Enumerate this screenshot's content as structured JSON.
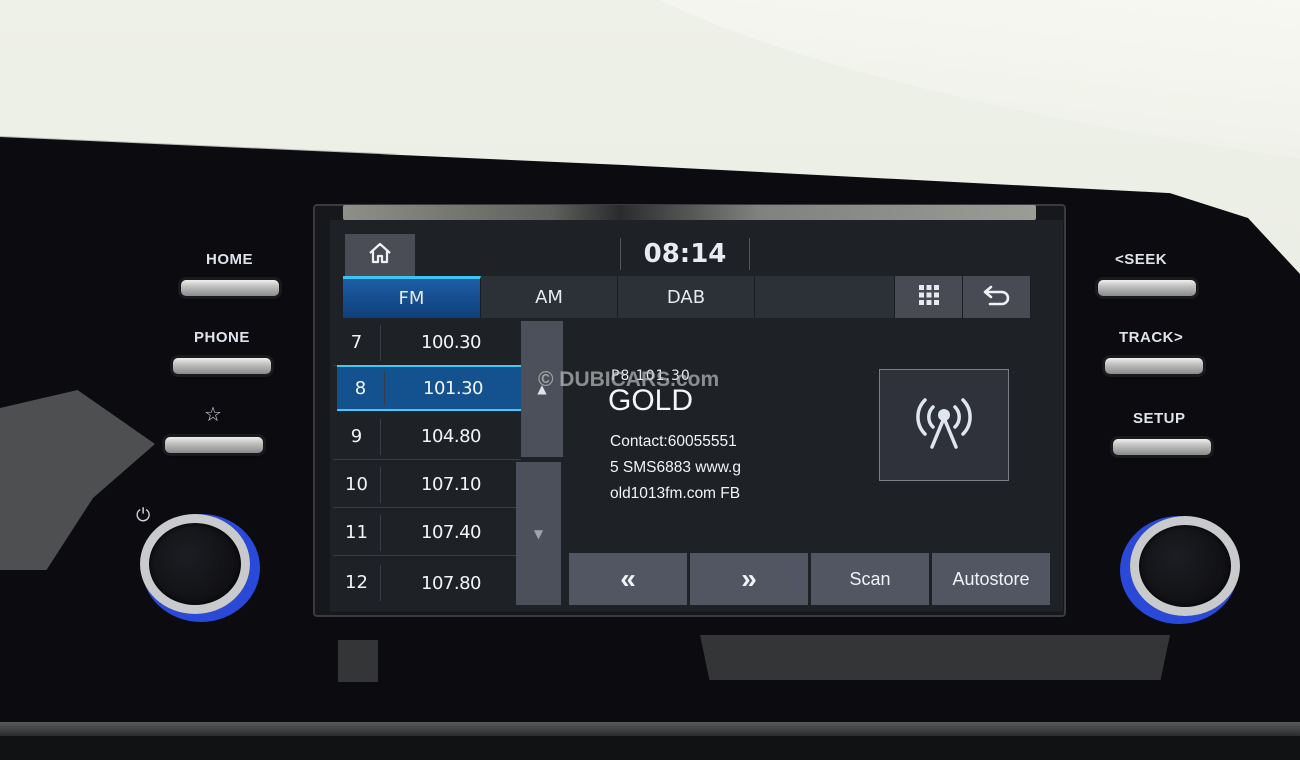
{
  "physical_controls": {
    "left": {
      "home_label": "HOME",
      "phone_label": "PHONE",
      "favorite_icon": "star-icon",
      "power_icon": "power-icon"
    },
    "right": {
      "seek_label": "<SEEK",
      "track_label": "TRACK>",
      "setup_label": "SETUP"
    }
  },
  "screen": {
    "header": {
      "home_icon": "home-icon",
      "clock": "08:14"
    },
    "tabs": [
      {
        "label": "FM",
        "active": true
      },
      {
        "label": "AM",
        "active": false
      },
      {
        "label": "DAB",
        "active": false
      }
    ],
    "tab_icons": {
      "menu": "grid-menu-icon",
      "back": "back-icon"
    },
    "presets": [
      {
        "num": "7",
        "freq": "100.30",
        "selected": false
      },
      {
        "num": "8",
        "freq": "101.30",
        "selected": true
      },
      {
        "num": "9",
        "freq": "104.80",
        "selected": false
      },
      {
        "num": "10",
        "freq": "107.10",
        "selected": false
      },
      {
        "num": "11",
        "freq": "107.40",
        "selected": false
      },
      {
        "num": "12",
        "freq": "107.80",
        "selected": false
      }
    ],
    "scroll": {
      "up_glyph": "▲",
      "down_glyph": "▼"
    },
    "station": {
      "preset_freq": "P8  101.30",
      "name": "GOLD",
      "rds_lines": [
        "Contact:60055551",
        "5 SMS6883 www.g",
        "old1013fm.com FB"
      ],
      "signal_icon": "radio-signal-icon"
    },
    "controls": {
      "prev_glyph": "«",
      "next_glyph": "»",
      "scan_label": "Scan",
      "autostore_label": "Autostore"
    }
  },
  "watermark": "© DUBICARS.com",
  "colors": {
    "accent_blue": "#14518f",
    "highlight_cyan": "#45c9f2",
    "knob_ring_blue": "#2b49d8"
  }
}
